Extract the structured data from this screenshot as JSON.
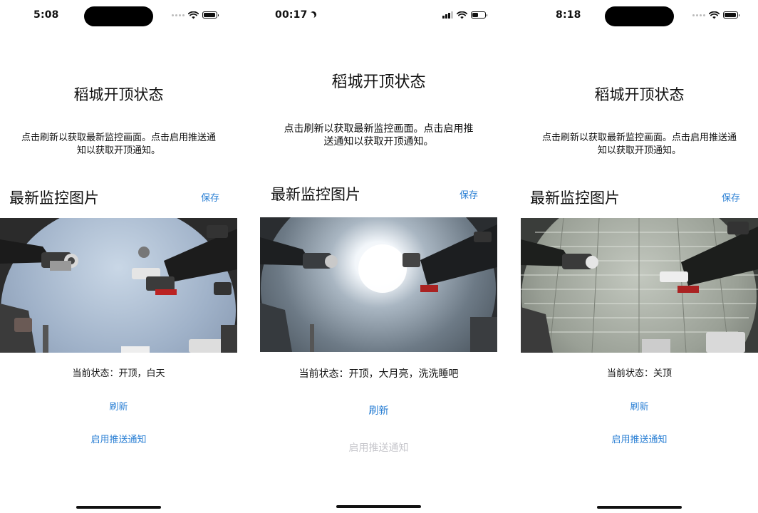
{
  "screens": [
    {
      "status_bar": {
        "time": "5:08",
        "dnd": false,
        "battery_level": 0.85
      },
      "title": "稻城开顶状态",
      "description": "点击刷新以获取最新监控画面。点击启用推送通知以获取开顶通知。",
      "section_title": "最新监控图片",
      "save_label": "保存",
      "image_scene": "daytime-open-sky",
      "state_label": "当前状态：",
      "state_value": "开顶，白天",
      "refresh_label": "刷新",
      "push_label": "启用推送通知",
      "push_enabled": true
    },
    {
      "status_bar": {
        "time": "00:17",
        "dnd": true,
        "battery_level": 0.45
      },
      "title": "稻城开顶状态",
      "description": "点击刷新以获取最新监控画面。点击启用推送通知以获取开顶通知。",
      "section_title": "最新监控图片",
      "save_label": "保存",
      "image_scene": "night-moon-sky",
      "state_label": "当前状态：",
      "state_value": "开顶，大月亮，洗洗睡吧",
      "refresh_label": "刷新",
      "push_label": "启用推送通知",
      "push_enabled": false
    },
    {
      "status_bar": {
        "time": "8:18",
        "dnd": false,
        "battery_level": 0.85
      },
      "title": "稻城开顶状态",
      "description": "点击刷新以获取最新监控画面。点击启用推送通知以获取开顶通知。",
      "section_title": "最新监控图片",
      "save_label": "保存",
      "image_scene": "closed-roof",
      "state_label": "当前状态：",
      "state_value": "关顶",
      "refresh_label": "刷新",
      "push_label": "启用推送通知",
      "push_enabled": true
    }
  ],
  "colors": {
    "accent": "#2a7fd4",
    "disabled": "#c7c7cc",
    "text": "#111111"
  }
}
